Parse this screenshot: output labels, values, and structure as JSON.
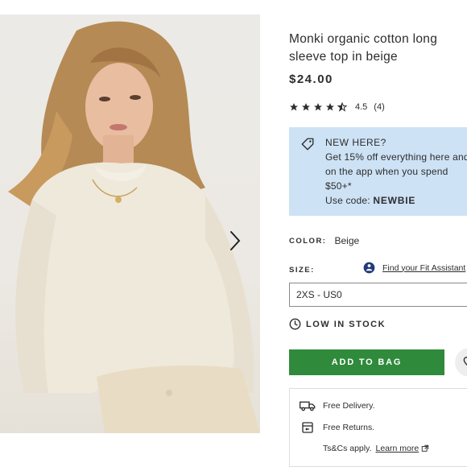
{
  "product": {
    "title": "Monki organic cotton long sleeve top in beige",
    "price": "$24.00",
    "rating": {
      "stars": 4.5,
      "value_text": "4.5",
      "count_text": "(4)"
    },
    "image": {
      "next_icon": "chevron-right-icon"
    }
  },
  "promo": {
    "icon": "tag-icon",
    "headline": "NEW HERE?",
    "body_line1": "Get 15% off everything here and",
    "body_line2": "on the app when you spend",
    "body_line3": "$50+*",
    "code_prefix": "Use code:",
    "code": "NEWBIE",
    "background": "#cde2f5"
  },
  "color": {
    "label": "COLOR:",
    "value": "Beige"
  },
  "size": {
    "label": "SIZE:",
    "fit_assistant": "Find your Fit Assistant",
    "selected": "2XS - US0"
  },
  "stock": {
    "icon": "clock-icon",
    "label": "LOW IN STOCK"
  },
  "actions": {
    "add_to_bag": "ADD TO BAG",
    "add_color": "#2f8a3b",
    "save_icon": "heart-icon"
  },
  "delivery": {
    "free_delivery": "Free Delivery.",
    "free_returns": "Free Returns.",
    "tcs_text": "Ts&Cs apply.",
    "learn_more": "Learn more"
  }
}
